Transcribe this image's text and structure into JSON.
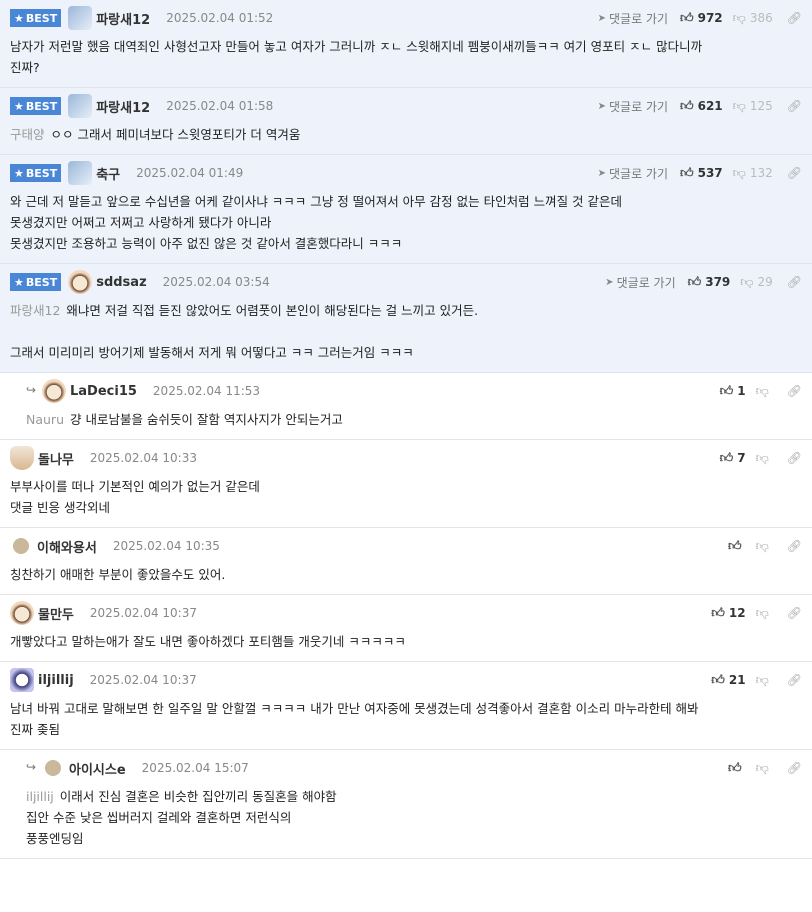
{
  "ui": {
    "goto_label": "댓글로 가기",
    "best_label": "BEST"
  },
  "comments": [
    {
      "best": true,
      "reply": false,
      "nick": "파랑새12",
      "date": "2025.02.04 01:52",
      "avatar": "sq",
      "up": "972",
      "down": "386",
      "goto": true,
      "mention": "",
      "lines": [
        "남자가 저런말 했음 대역죄인 사형선고자 만들어 놓고 여자가 그러니까 ㅈㄴ 스윗해지네 펨붕이새끼들ㅋㅋ 여기 영포티 ㅈㄴ 많다니까",
        "진짜?"
      ]
    },
    {
      "best": true,
      "reply": false,
      "nick": "파랑새12",
      "date": "2025.02.04 01:58",
      "avatar": "sq",
      "up": "621",
      "down": "125",
      "goto": true,
      "mention": "구태양",
      "lines": [
        "ㅇㅇ 그래서 페미녀보다 스윗영포티가 더 역겨움"
      ]
    },
    {
      "best": true,
      "reply": false,
      "nick": "축구",
      "date": "2025.02.04 01:49",
      "avatar": "sq",
      "up": "537",
      "down": "132",
      "goto": true,
      "mention": "",
      "lines": [
        "와 근데 저 말듣고 앞으로 수십년을 어케 같이사냐 ㅋㅋㅋ 그냥 정 떨어져서 아무 감정 없는 타인처럼 느껴질 것 같은데",
        "못생겼지만 어쩌고 저쩌고 사랑하게 됐다가 아니라",
        "못생겼지만 조용하고 능력이 아주 없진 않은 것 같아서 결혼했다라니 ㅋㅋㅋ"
      ]
    },
    {
      "best": true,
      "reply": false,
      "nick": "sddsaz",
      "date": "2025.02.04 03:54",
      "avatar": "dog",
      "up": "379",
      "down": "29",
      "goto": true,
      "mention": "파랑새12",
      "lines": [
        "왜냐면 저걸 직접 듣진 않았어도 어렴풋이 본인이 해당된다는 걸 느끼고 있거든.",
        "",
        "그래서 미리미리 방어기제 발동해서 저게 뭐 어떻다고 ㅋㅋ 그러는거임 ㅋㅋㅋ"
      ]
    },
    {
      "best": false,
      "reply": true,
      "nick": "LaDeci15",
      "date": "2025.02.04 11:53",
      "avatar": "dog",
      "up": "1",
      "down": "",
      "goto": false,
      "mention": "Nauru",
      "lines": [
        "걍 내로남불을 숨쉬듯이 잘함 역지사지가 안되는거고"
      ]
    },
    {
      "best": false,
      "reply": false,
      "nick": "돌나무",
      "date": "2025.02.04 10:33",
      "avatar": "fox",
      "up": "7",
      "down": "",
      "goto": false,
      "mention": "",
      "lines": [
        "부부사이를 떠나 기본적인 예의가 없는거 같은데",
        "댓글 빈응 생각외네"
      ]
    },
    {
      "best": false,
      "reply": false,
      "nick": "이해와용서",
      "date": "2025.02.04 10:35",
      "avatar": "dot",
      "up": "",
      "down": "",
      "goto": false,
      "mention": "",
      "lines": [
        "칭찬하기 애매한 부분이 좋았을수도 있어."
      ]
    },
    {
      "best": false,
      "reply": false,
      "nick": "물만두",
      "date": "2025.02.04 10:37",
      "avatar": "dog",
      "up": "12",
      "down": "",
      "goto": false,
      "mention": "",
      "lines": [
        "개빻았다고 말하는애가 잘도 내면 좋아하겠다 포티햄들 개웃기네 ㅋㅋㅋㅋㅋ"
      ]
    },
    {
      "best": false,
      "reply": false,
      "nick": "iljillij",
      "date": "2025.02.04 10:37",
      "avatar": "vio",
      "up": "21",
      "down": "",
      "goto": false,
      "mention": "",
      "lines": [
        "남녀 바꿔 고대로 말해보면 한 일주일 말 안할껄 ㅋㅋㅋㅋ 내가 만난 여자중에 못생겼는데 성격좋아서 결혼함 이소리 마누라한테 해봐",
        "진짜 좆됨"
      ]
    },
    {
      "best": false,
      "reply": true,
      "nick": "아이시스e",
      "date": "2025.02.04 15:07",
      "avatar": "dot",
      "up": "",
      "down": "",
      "goto": false,
      "mention": "iljillij",
      "lines": [
        "이래서 진심 결혼은 비슷한 집안끼리 동질혼을 해야함",
        "집안 수준 낮은 씹버러지 걸레와 결혼하면 저런식의",
        "풍풍엔딩임"
      ]
    }
  ]
}
